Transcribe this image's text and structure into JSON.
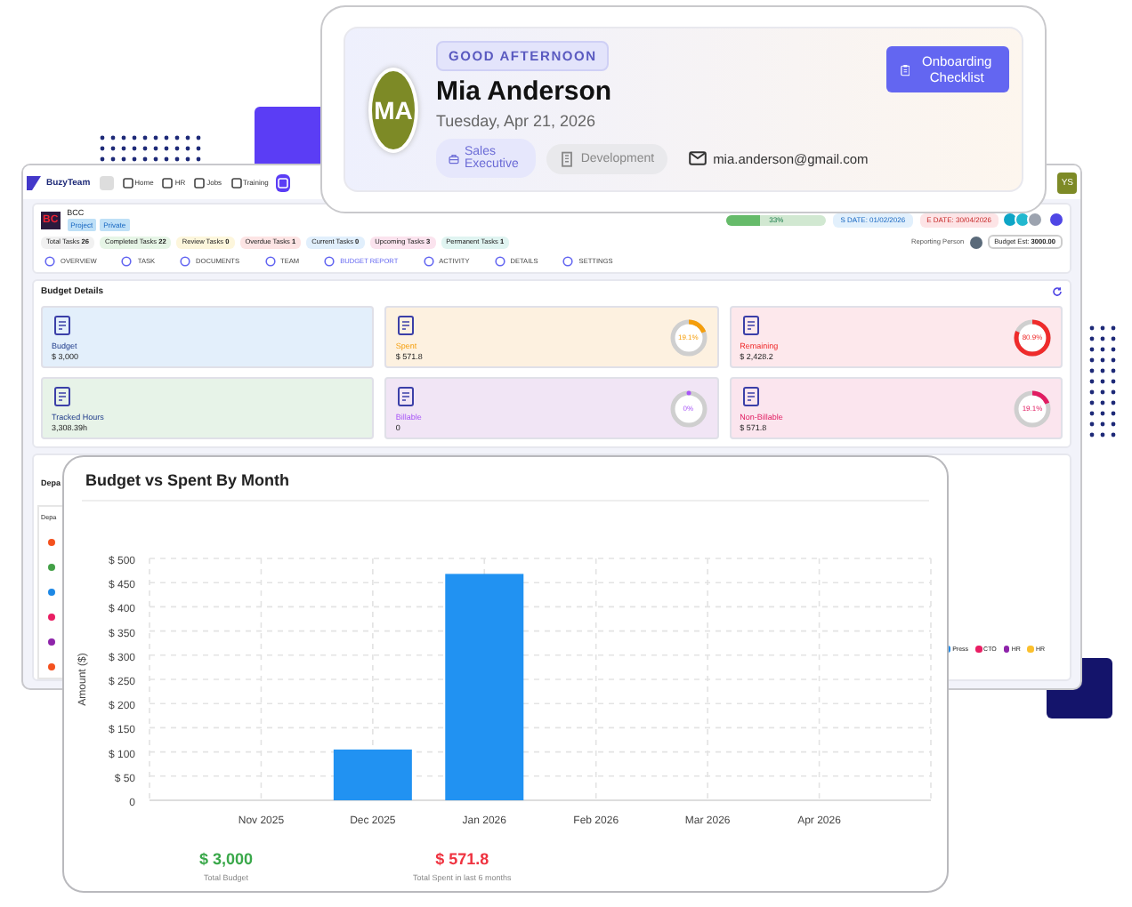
{
  "dashboard": {
    "logo": "BuzyTeam",
    "nav": [
      {
        "label": "Home",
        "selected": false
      },
      {
        "label": "HR",
        "selected": false
      },
      {
        "label": "Jobs",
        "selected": false
      },
      {
        "label": "Training",
        "selected": false
      },
      {
        "selected": true
      }
    ],
    "user_avatar": "YS",
    "project": {
      "icon": "BC",
      "name": "BCC",
      "tags": [
        "Project",
        "Private"
      ],
      "progress": {
        "level": 0.33,
        "label": "33%"
      },
      "start_date": "S DATE: 01/02/2026",
      "end_date": "E DATE: 30/04/2026"
    },
    "task_counts": [
      {
        "label": "Total Tasks",
        "count": "26",
        "color": "#f1f1f1"
      },
      {
        "label": "Completed Tasks",
        "count": "22",
        "color": "#e6f5e6"
      },
      {
        "label": "Review Tasks",
        "count": "0",
        "color": "#fdf6dc"
      },
      {
        "label": "Overdue Tasks",
        "count": "1",
        "color": "#fde4e4"
      },
      {
        "label": "Current Tasks",
        "count": "0",
        "color": "#e1effc"
      },
      {
        "label": "Upcoming Tasks",
        "count": "3",
        "color": "#fbe3ee"
      },
      {
        "label": "Permanent Tasks",
        "count": "1",
        "color": "#e0f4f1"
      }
    ],
    "reporting_person": "Reporting Person",
    "budget_est": {
      "label": "Budget Est:",
      "value": "3000.00"
    },
    "tabs": [
      {
        "label": "OVERVIEW",
        "selected": false
      },
      {
        "label": "TASK",
        "selected": false
      },
      {
        "label": "DOCUMENTS",
        "selected": false
      },
      {
        "label": "TEAM",
        "selected": false
      },
      {
        "label": "BUDGET REPORT",
        "selected": true
      },
      {
        "label": "ACTIVITY",
        "selected": false
      },
      {
        "label": "DETAILS",
        "selected": false
      },
      {
        "label": "SETTINGS",
        "selected": false
      }
    ],
    "section_title": "Budget Details",
    "cards": [
      {
        "label": "Budget",
        "value": "$ 3,000",
        "color": "#e3effb"
      },
      {
        "label": "Spent",
        "value": "$ 571.8",
        "color": "#fdf1e0",
        "ring": {
          "level": 0.191,
          "label": "19.1%",
          "color": "#f59e0b"
        }
      },
      {
        "label": "Remaining",
        "value": "$ 2,428.2",
        "color": "#fde8ec",
        "ring": {
          "level": 0.809,
          "label": "80.9%",
          "color": "#ef2b2b"
        }
      },
      {
        "label": "Tracked Hours",
        "value": "3,308.39h",
        "color": "#e7f3e8"
      },
      {
        "label": "Billable",
        "value": "0",
        "color": "#f1e5f5",
        "ring": {
          "level": 0,
          "label": "0%",
          "color": "#a855f7"
        }
      },
      {
        "label": "Non-Billable",
        "value": "$ 571.8",
        "color": "#fbe5ee",
        "ring": {
          "level": 0.191,
          "label": "19.1%",
          "color": "#e11d62"
        }
      }
    ],
    "department_title": "Depa",
    "department_header": "Depa",
    "department_dots": [
      {
        "color": "#f4511e"
      },
      {
        "color": "#43a047"
      },
      {
        "color": "#1e88e5"
      },
      {
        "color": "#e91e63"
      },
      {
        "color": "#8e24aa"
      },
      {
        "color": "#f4511e"
      }
    ],
    "legend": [
      {
        "label": "Press",
        "color": "#1e88e5"
      },
      {
        "label": "CTO",
        "color": "#e91e63"
      },
      {
        "label": "HR",
        "color": "#8e24aa"
      },
      {
        "label": "HR",
        "color": "#fbc02d"
      }
    ]
  },
  "profile_card": {
    "greeting": "GOOD AFTERNOON",
    "avatar_initials": "MA",
    "name": "Mia Anderson",
    "date": "Tuesday, Apr 21, 2026",
    "tags": [
      {
        "label": "Sales Executive",
        "kind": "role"
      },
      {
        "label": "Development",
        "kind": "department"
      }
    ],
    "email": "mia.anderson@gmail.com",
    "button": "Onboarding Checklist"
  },
  "chart_card": {
    "title": "Budget vs Spent By Month",
    "chart_data": {
      "type": "bar",
      "ylabel": "Amount ($)",
      "grid": true,
      "categories": [
        "Nov 2025",
        "Dec 2025",
        "Jan 2026",
        "Feb 2026",
        "Mar 2026",
        "Apr 2026"
      ],
      "values": [
        0,
        105,
        468,
        0,
        0,
        0
      ],
      "ylim": [
        0,
        500
      ],
      "yticks": [
        {
          "value": 0,
          "label": "0"
        },
        {
          "value": 50,
          "label": "$ 50"
        },
        {
          "value": 100,
          "label": "$ 100"
        },
        {
          "value": 150,
          "label": "$ 150"
        },
        {
          "value": 200,
          "label": "$ 200"
        },
        {
          "value": 250,
          "label": "$ 250"
        },
        {
          "value": 300,
          "label": "$ 300"
        },
        {
          "value": 350,
          "label": "$ 350"
        },
        {
          "value": 400,
          "label": "$ 400"
        },
        {
          "value": 450,
          "label": "$ 450"
        },
        {
          "value": 500,
          "label": "$ 500"
        }
      ]
    },
    "summary": [
      {
        "value": "$ 3,000",
        "label": "Total Budget",
        "kind": "budget"
      },
      {
        "value": "$ 571.8",
        "label": "Total Spent in last 6 months",
        "kind": "spent"
      }
    ]
  }
}
